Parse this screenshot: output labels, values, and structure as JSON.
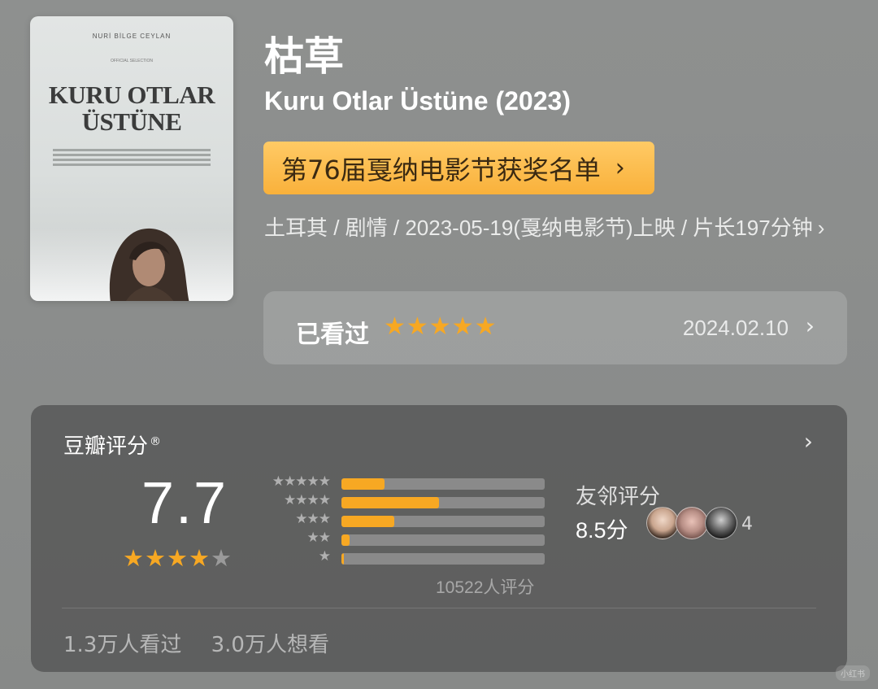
{
  "poster": {
    "director": "NURİ BİLGE CEYLAN",
    "selection": "OFFICIAL SELECTION",
    "title_line1": "KURU OTLAR",
    "title_line2": "ÜSTÜNE"
  },
  "movie": {
    "title_cn": "枯草",
    "title_original": "Kuru Otlar Üstüne (2023)",
    "festival_label": "第76届戛纳电影节获奖名单",
    "meta": "土耳其 / 剧情 / 2023-05-19(戛纳电影节)上映 / 片长197分钟"
  },
  "watched": {
    "label": "已看过",
    "stars": "★★★★★",
    "date": "2024.02.10"
  },
  "rating": {
    "title": "豆瓣评分",
    "registered_mark": "®",
    "score": "7.7",
    "stars_on": "★★★★",
    "stars_off": "★",
    "count": "10522人评分",
    "distribution": [
      {
        "label": "★★★★★",
        "fraction": 0.21
      },
      {
        "label": "★★★★",
        "fraction": 0.48
      },
      {
        "label": "★★★",
        "fraction": 0.26
      },
      {
        "label": "★★",
        "fraction": 0.04
      },
      {
        "label": "★",
        "fraction": 0.01
      }
    ],
    "friends_label": "友邻评分",
    "friends_score": "8.5分",
    "friends_count": "4",
    "watched_count": "1.3万人看过",
    "want_count": "3.0万人想看"
  },
  "colors": {
    "accent": "#f7a823",
    "festival_bg": "#fbb843",
    "card_bg": "#555555"
  },
  "icons": [
    "chevron-right-icon",
    "star-icon",
    "avatar"
  ]
}
